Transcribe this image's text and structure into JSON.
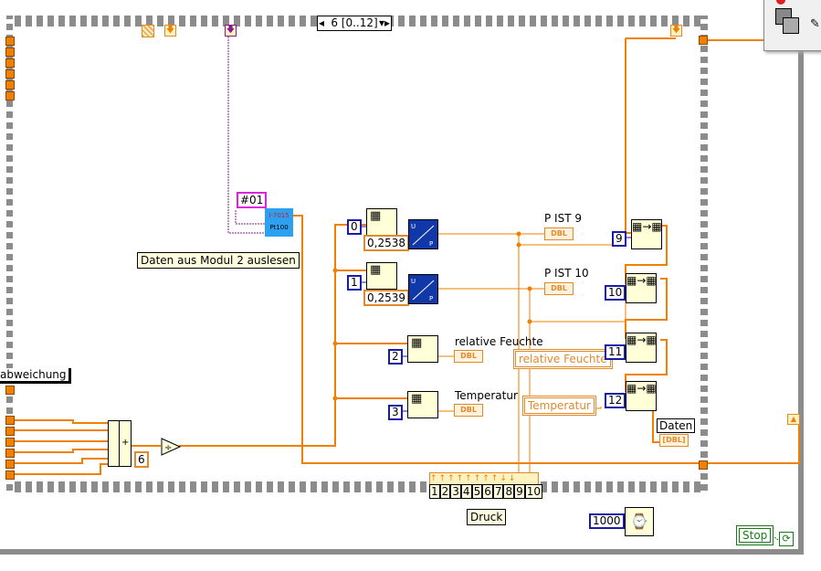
{
  "sequence": {
    "selector": "6 [0..12]"
  },
  "module": {
    "address": "#01",
    "device_line1": "I-7015",
    "device_line2": "Pt100",
    "comment": "Daten aus Modul 2 auslesen"
  },
  "left_label": "abweichung",
  "indices": [
    "0",
    "1",
    "2",
    "3",
    "9",
    "10",
    "11",
    "12"
  ],
  "factors": [
    "0,2538",
    "0,2539"
  ],
  "divisor": "6",
  "indicators": [
    {
      "label": "P IST 9",
      "type": "DBL"
    },
    {
      "label": "P IST 10",
      "type": "DBL"
    },
    {
      "label": "relative Feuchte",
      "type": "DBL"
    },
    {
      "label": "Temperatur",
      "type": "DBL"
    },
    {
      "label": "Daten",
      "type": "[DBL]"
    }
  ],
  "locals": [
    "relative Feuchte",
    "Temperatur"
  ],
  "cluster": {
    "label": "Druck",
    "elements": [
      "1",
      "2",
      "3",
      "4",
      "5",
      "6",
      "7",
      "8",
      "9",
      "10"
    ]
  },
  "wait": {
    "ms": "1000"
  },
  "stop": {
    "label": "Stop"
  },
  "colors": {
    "wire_dbl": "#f08000",
    "wire_int": "#1a1aa8",
    "frame": "#8c8c8c",
    "bool": "#1a7a1a"
  }
}
